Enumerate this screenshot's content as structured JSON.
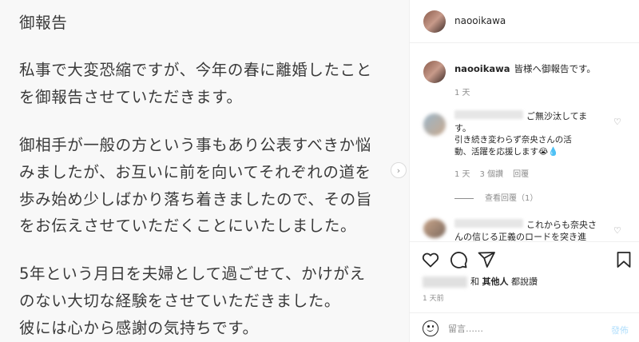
{
  "post_image": {
    "lines": [
      "御報告",
      "私事で大変恐縮ですが、今年の春に離婚したこと",
      "を御報告させていただきます。",
      "御相手が一般の方という事もあり公表すべきか悩",
      "みましたが、お互いに前を向いてそれぞれの道を",
      "歩み始め少しばかり落ち着きましたので、その旨",
      "をお伝えさせていただくことにいたしました。",
      "5年という月日を夫婦として過ごせて、かけがえ",
      "のない大切な経験をさせていただきました。",
      "彼には心から感謝の気持ちです。"
    ],
    "next_icon": "chevron-right-icon"
  },
  "header": {
    "username": "naooikawa"
  },
  "caption": {
    "username": "naooikawa",
    "text": "皆様へ御報告です。",
    "time": "1 天"
  },
  "comments": [
    {
      "text_lines": [
        "ご無沙汰してま",
        "す。",
        "引き続き変わらず奈央さんの活",
        "動、活躍を応援します😭💧"
      ],
      "time": "1 天",
      "likes": "3 個讚",
      "reply": "回覆",
      "view_replies": "查看回覆（1）"
    },
    {
      "text_lines": [
        "これからも奈央さ",
        "んの信じる正義のロードを突き進"
      ]
    }
  ],
  "actions": {
    "like_icon": "heart-icon",
    "comment_icon": "comment-icon",
    "share_icon": "paper-plane-icon",
    "save_icon": "bookmark-icon",
    "likes_text_and": "和",
    "likes_text_others": "其他人",
    "likes_text_suffix": "都說讚",
    "post_time": "1 天前"
  },
  "add_comment": {
    "placeholder": "留言……",
    "post_label": "發佈",
    "emoji_icon": "smiley-icon"
  }
}
